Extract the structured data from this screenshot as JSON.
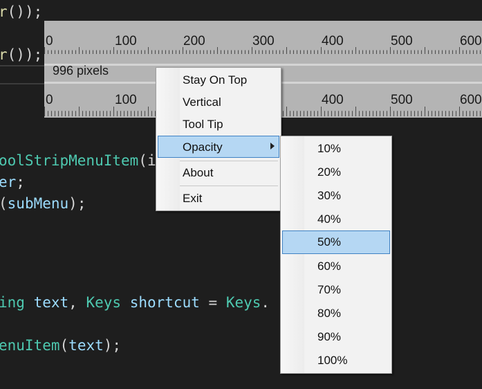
{
  "code": {
    "line1": {
      "method": "r",
      "punct": "());"
    },
    "line2": {
      "method": "r",
      "punct": "());"
    },
    "line3": {
      "type": "oolStripMenuItem",
      "punct": "(i"
    },
    "line4": {
      "param": "er",
      "punct": ";"
    },
    "line5": {
      "punct_open": "(",
      "param": "subMenu",
      "punct": ");"
    },
    "line6": {
      "kw": "ing",
      "param1": "text",
      "comma": ",",
      "type": "Keys",
      "param2": "shortcut",
      "eq": "=",
      "type2": "Keys",
      "dot": "."
    },
    "line7": {
      "type": "enuItem",
      "punct_open": "(",
      "param": "text",
      "punct": ");"
    }
  },
  "ruler": {
    "top_labels": [
      "0",
      "100",
      "200",
      "300",
      "400",
      "500",
      "600"
    ],
    "bottom_labels": [
      "0",
      "100",
      "400",
      "500",
      "600"
    ],
    "readout": "996 pixels"
  },
  "context_menu": {
    "items": [
      {
        "label": "Stay On Top"
      },
      {
        "label": "Vertical"
      },
      {
        "label": "Tool Tip"
      },
      {
        "label": "Opacity",
        "has_submenu": true,
        "selected": true
      },
      {
        "label": "About"
      },
      {
        "label": "Exit"
      }
    ]
  },
  "opacity_menu": {
    "items": [
      "10%",
      "20%",
      "30%",
      "40%",
      "50%",
      "60%",
      "70%",
      "80%",
      "90%",
      "100%"
    ],
    "selected": "50%"
  },
  "colors": {
    "selection_bg": "#b5d7f3",
    "selection_border": "#3f82c4",
    "ruler_bg": "#b4b4b4",
    "editor_bg": "#1e1e1e"
  }
}
